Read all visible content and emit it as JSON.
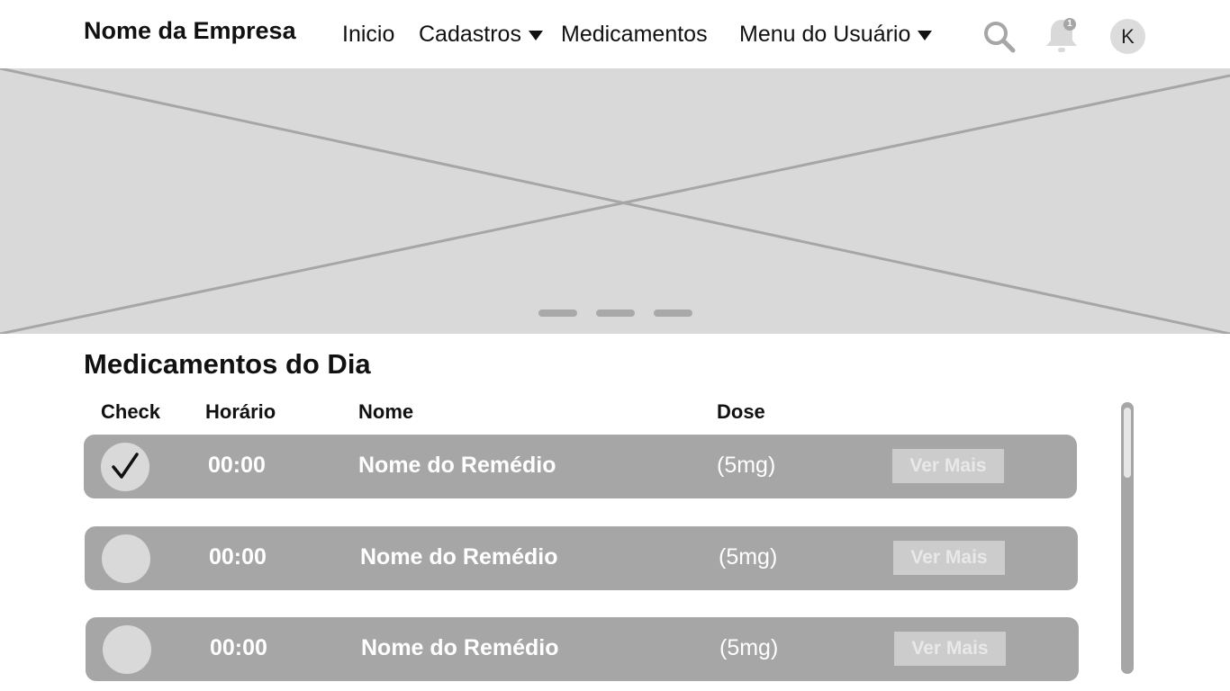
{
  "navbar": {
    "brand": "Nome da Empresa",
    "items": [
      {
        "label": "Inicio"
      },
      {
        "label": "Cadastros"
      },
      {
        "label": "Medicamentos"
      },
      {
        "label": "Menu do Usuário"
      }
    ],
    "notification_count": "1",
    "avatar_initial": "K",
    "icons": [
      "search-icon",
      "bell-icon",
      "chevron-down-icon"
    ]
  },
  "carousel": {
    "slides": 3,
    "active_slide": 1
  },
  "section": {
    "title": "Medicamentos do Dia",
    "columns": [
      "Check",
      "Horário",
      "Nome",
      "Dose"
    ]
  },
  "rows": [
    {
      "checked": true,
      "time": "00:00",
      "name": "Nome do Remédio",
      "dose": "(5mg)",
      "action": "Ver Mais"
    },
    {
      "checked": false,
      "time": "00:00",
      "name": "Nome do Remédio",
      "dose": "(5mg)",
      "action": "Ver Mais"
    },
    {
      "checked": false,
      "time": "00:00",
      "name": "Nome do Remédio",
      "dose": "(5mg)",
      "action": "Ver Mais"
    }
  ],
  "colors": {
    "row_bg": "#a6a6a6",
    "placeholder_bg": "#d9d9d9",
    "text_dark": "#111111",
    "text_light": "#ffffff"
  }
}
